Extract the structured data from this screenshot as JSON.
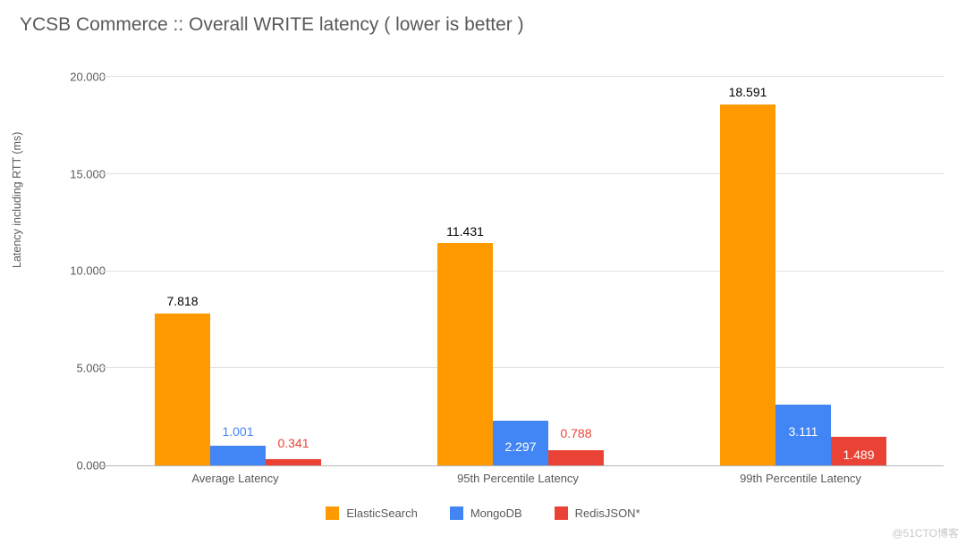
{
  "title": "YCSB Commerce :: Overall WRITE latency ( lower is better )",
  "ylabel": "Latency including RTT (ms)",
  "watermark": "@51CTO博客",
  "y_ticks": [
    "0.000",
    "5.000",
    "10.000",
    "15.000",
    "20.000"
  ],
  "legend": {
    "es": "ElasticSearch",
    "md": "MongoDB",
    "rj": "RedisJSON*"
  },
  "colors": {
    "es": "#ff9900",
    "md": "#4285f4",
    "rj": "#ea4335"
  },
  "categories": {
    "0": "Average Latency",
    "1": "95th Percentile Latency",
    "2": "99th Percentile Latency"
  },
  "values": {
    "g0": {
      "es": "7.818",
      "md": "1.001",
      "rj": "0.341"
    },
    "g1": {
      "es": "11.431",
      "md": "2.297",
      "rj": "0.788"
    },
    "g2": {
      "es": "18.591",
      "md": "3.111",
      "rj": "1.489"
    }
  },
  "chart_data": {
    "type": "bar",
    "title": "YCSB Commerce :: Overall WRITE latency ( lower is better )",
    "xlabel": "",
    "ylabel": "Latency including RTT (ms)",
    "ylim": [
      0,
      20
    ],
    "categories": [
      "Average Latency",
      "95th Percentile Latency",
      "99th Percentile Latency"
    ],
    "series": [
      {
        "name": "ElasticSearch",
        "color": "#ff9900",
        "values": [
          7.818,
          11.431,
          18.591
        ]
      },
      {
        "name": "MongoDB",
        "color": "#4285f4",
        "values": [
          1.001,
          2.297,
          3.111
        ]
      },
      {
        "name": "RedisJSON*",
        "color": "#ea4335",
        "values": [
          0.341,
          0.788,
          1.489
        ]
      }
    ],
    "legend_position": "bottom",
    "grid": true
  }
}
